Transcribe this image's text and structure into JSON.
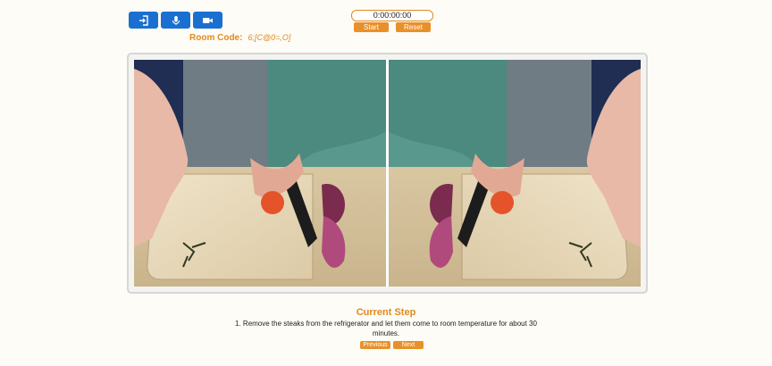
{
  "toolbar": {
    "buttons": [
      {
        "icon": "login-icon"
      },
      {
        "icon": "microphone-icon"
      },
      {
        "icon": "video-camera-icon"
      }
    ],
    "accent": "#1b6fd1"
  },
  "room": {
    "label": "Room Code:",
    "code": "6;[C@0=,O]"
  },
  "timer": {
    "value": "0:00:00:00",
    "start_label": "Start",
    "reset_label": "Reset"
  },
  "step": {
    "heading": "Current Step",
    "text": "1. Remove the steaks from the refrigerator and let them come to room temperature for about 30 minutes.",
    "previous_label": "Previous",
    "next_label": "Next"
  },
  "colors": {
    "orange": "#e08a20",
    "background": "#fdfcf6"
  }
}
